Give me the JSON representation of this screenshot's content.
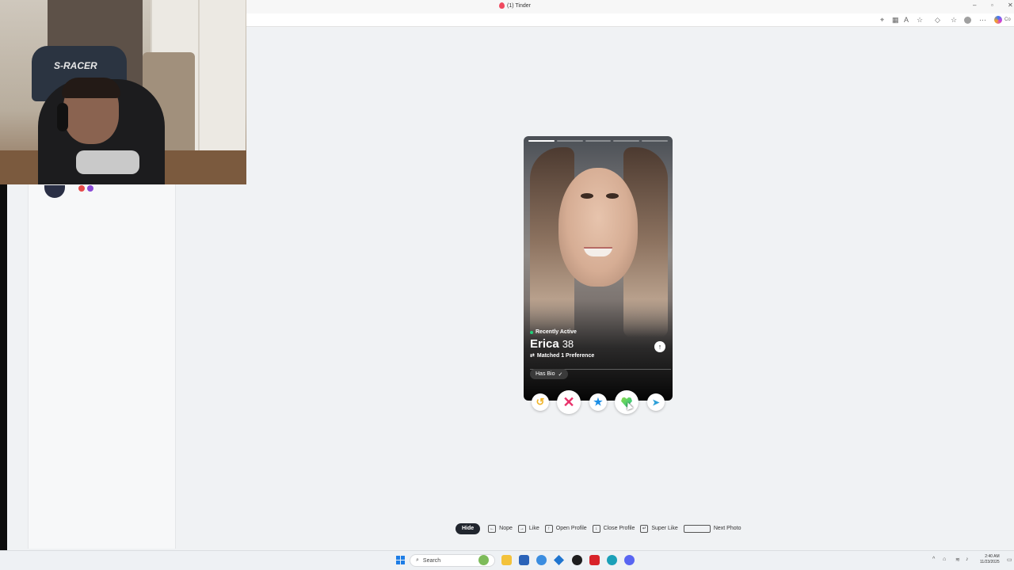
{
  "browser": {
    "tab_title": "(1) Tinder",
    "minimize": "–",
    "maximize": "▫",
    "close": "✕",
    "profile_label": "Co"
  },
  "profile_card": {
    "status": "Recently Active",
    "name": "Erica",
    "age": "38",
    "matched": "Matched 1 Preference",
    "bio_chip": "Has Bio",
    "photo_count": 5,
    "active_photo": 0
  },
  "actions": {
    "rewind": "↺",
    "nope": "✕",
    "super_like": "★",
    "boost": "➤",
    "expand": "↑"
  },
  "shortcuts": {
    "hide": "Hide",
    "items": [
      {
        "key": "←",
        "label": "Nope"
      },
      {
        "key": "→",
        "label": "Like"
      },
      {
        "key": "↑",
        "label": "Open Profile"
      },
      {
        "key": "↓",
        "label": "Close Profile"
      },
      {
        "key": "↵",
        "label": "Super Like"
      }
    ],
    "next_photo": "Next Photo"
  },
  "webcam": {
    "chair_text": "S-RACER"
  },
  "taskbar": {
    "search_placeholder": "Search",
    "time": "2:40 AM",
    "date": "11/23/2025"
  },
  "colors": {
    "nope": "#e8316a",
    "like": "#22c58b",
    "super_like": "#1b8ee6",
    "rewind": "#f0b429",
    "active_dot": "#21d07a"
  }
}
